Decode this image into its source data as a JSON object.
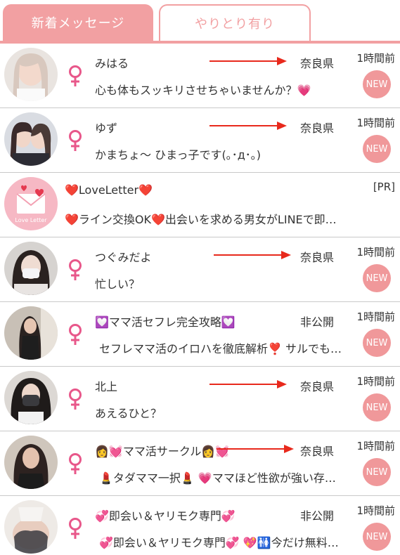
{
  "tabs": {
    "new_messages": "新着メッセージ",
    "exchanged": "やりとり有り"
  },
  "colors": {
    "accent": "#f2a0a2",
    "badge": "#f0989a",
    "female_symbol": "#e8578a",
    "arrow": "#e8291c"
  },
  "new_badge_label": "NEW",
  "rows": [
    {
      "name": "みはる",
      "message": "心も体もスッキリさせちゃいませんか？💗",
      "prefecture": "奈良県",
      "time": "1時間前",
      "avatar_icon": "user-photo-icon"
    },
    {
      "name": "ゆず",
      "message": "かまちょ～ ひまっ子です(｡･д･｡)",
      "prefecture": "奈良県",
      "time": "1時間前",
      "avatar_icon": "user-photo-icon"
    },
    {
      "name": "❤️LoveLetter❤️",
      "message": "❤️ライン交換OK❤️出会いを求める男女がLINEで即…",
      "tag": "[PR]",
      "avatar_text": "Love Letter",
      "avatar_icon": "love-letter-logo"
    },
    {
      "name": "つぐみだよ",
      "message": "忙しい？",
      "prefecture": "奈良県",
      "time": "1時間前",
      "avatar_icon": "user-photo-icon"
    },
    {
      "name": "💟ママ活セフレ完全攻略💟",
      "message": "セフレママ活のイロハを徹底解析❣️ サルでも…",
      "prefecture": "非公開",
      "time": "1時間前",
      "avatar_icon": "user-photo-icon"
    },
    {
      "name": "北上",
      "message": "あえるひと？",
      "prefecture": "奈良県",
      "time": "1時間前",
      "avatar_icon": "user-photo-icon"
    },
    {
      "name": "👩💓ママ活サークル👩💓",
      "message": "💄タダママ一択💄 💗ママほど性欲が強い存…",
      "prefecture": "奈良県",
      "time": "1時間前",
      "avatar_icon": "user-photo-icon"
    },
    {
      "name": "💞即会い＆ヤリモク専門💞",
      "message": "💞即会い＆ヤリモク専門💞 💖🚻今だけ無料…",
      "prefecture": "非公開",
      "time": "1時間前",
      "avatar_icon": "user-photo-icon"
    }
  ]
}
